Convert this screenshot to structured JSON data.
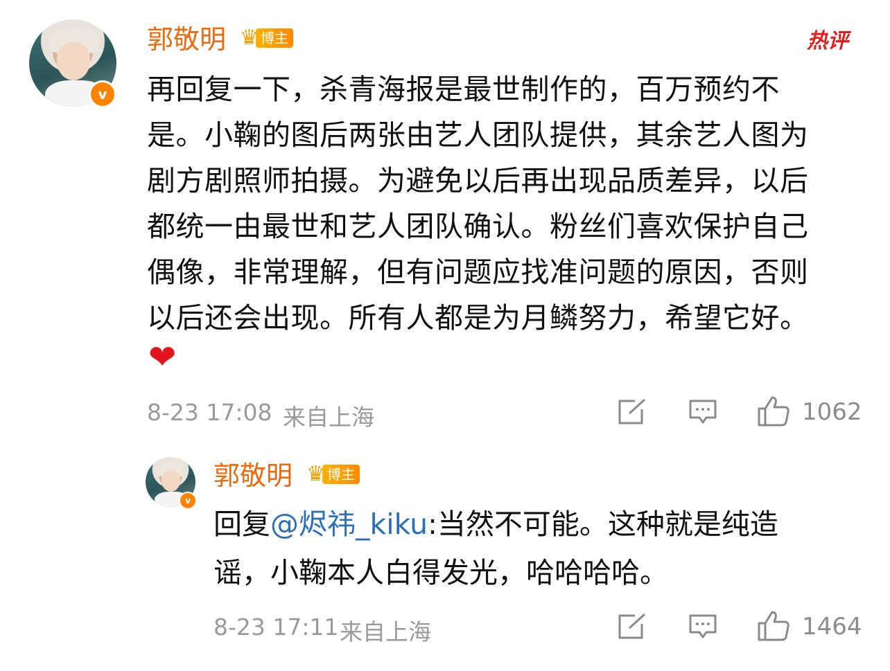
{
  "hot_label": "热评",
  "comment": {
    "username": "郭敬明",
    "badge_label": "博主",
    "badge_level": "7",
    "verified_mark": "v",
    "content_lines": [
      "再回复一下，杀青海报是最世制作的，百万预约不",
      "是。小鞠的图后两张由艺人团队提供，其余艺人图为",
      "剧方剧照师拍摄。为避免以后再出现品质差异，以后",
      "都统一由最世和艺人团队确认。粉丝们喜欢保护自己",
      "偶像，非常理解，但有问题应找准问题的原因，否则",
      "以后还会出现。所有人都是为月鳞努力，希望它好。"
    ],
    "emoji": "❤",
    "timestamp": "8-23 17:08",
    "location": "来自上海",
    "like_count": "1062"
  },
  "reply": {
    "username": "郭敬明",
    "badge_label": "博主",
    "badge_level": "7",
    "verified_mark": "v",
    "reply_prefix": "回复",
    "mention": "@烬祎_kiku",
    "line1_rest": ":当然不可能。这种就是纯造",
    "line2": "谣，小鞠本人白得发光，哈哈哈哈。",
    "timestamp": "8-23 17:11",
    "location": "来自上海",
    "like_count": "1464"
  },
  "colors": {
    "username": "#e86b0f",
    "mention": "#2a6fb7",
    "meta": "#9a9a9a",
    "hot": "#e02020",
    "verified": "#ff8200"
  }
}
